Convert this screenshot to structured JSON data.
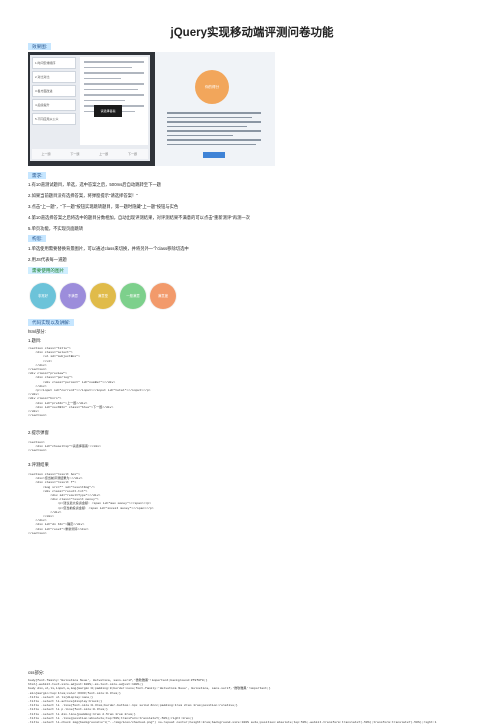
{
  "title": "jQuery实现移动端评测问卷功能",
  "section_effect": "效果图:",
  "demo": {
    "list": [
      "1.时间安排顺序",
      "2.对比对比",
      "3.各方面改进",
      "4.后续提升",
      "5.不同应用从公众"
    ],
    "popup_text": "请选择答案",
    "nav": [
      "上一题",
      "下一题",
      "上一题",
      "下一题"
    ],
    "circle_text": "你的得分"
  },
  "section_requirements": "需求:",
  "requirements": [
    "1.有10道测试题目，单选，选中答案之后，500ms后自动跳转至下一题",
    "2.如果当前题目没有选择答案，将弹窗提示\"请选择答案！\"",
    "3.点击\"上一题\"，\"下一题\"按钮实现跳转题目，第一题时隐藏\"上一题\"按钮与实色",
    "4.第10道选择答案之后将选中的题目分数相加，自动出现评测结果，对评测结果不满意的可以点击\"重新测评\"再测一次",
    "5.单页功能，不实现页面跳转"
  ],
  "section_analysis": "构思:",
  "analysis": [
    "1.单选使用需要替换背景图片，可以通过class来切换，并将另外一个class移除切选中",
    "2.用JS代表每一道题"
  ],
  "section_images": "需要使用的图片",
  "circles": [
    {
      "label": "非常好",
      "color": "#6cc3d9"
    },
    {
      "label": "不满意",
      "color": "#9c8ddb"
    },
    {
      "label": "满意型",
      "color": "#e0bb4a"
    },
    {
      "label": "一般满意",
      "color": "#7dd08c"
    },
    {
      "label": "满意度",
      "color": "#f29a6b"
    }
  ],
  "section_code": "代码实现以及讲解:",
  "html_part": "html部分:",
  "part1": "1.题目:",
  "code1": [
    "<section class=\"title\">",
    "    <div class=\"select\">",
    "        <ul id=\"subjectBox\">",
    "",
    "        </ul>",
    "    </div>",
    "</section>",
    "<div class=\"preview\">",
    "    <div class=\"porlog\">",
    "        <div class=\"percent\" id=\"numBer\"></div>",
    "    </div>",
    "    <p><input id=\"current\"></input></input id=\"total\"></input></p>",
    "</div>",
    "<div class=\"bnrs\">",
    "    <div id=\"prebtn\">上一题</div>",
    "    <div id=\"nextBtn\" class=\"blue\">下一题</div>",
    "</div>",
    "</section>"
  ],
  "part2": "2.提示弹窗",
  "code2": [
    "<section>",
    "    <div id=\"choseltip\">请选择答案!</div>",
    "</section>"
  ],
  "part3": "3.评测结果",
  "code3": [
    "<section class=\"result box\">",
    "    <div>您当前评测结果为:</div>",
    "    <div class=\"result f\">",
    "        <img src=\"\" id=\"resultImg\"/>",
    "        <div class=\"result-txt\">",
    "            <div id=\"resultType\"></div>",
    "            <div class=\"result money\">",
    "                <p>建议最大投资金额: <span id=\"max money\"></span></p>",
    "                <p>您当前投资金额: <span id=\"invest money\"></span></p>",
    "            </div>",
    "        </div>",
    "    </div>",
    "    <div id=\"dn btn\">确定</div>",
    "    <div id=\"reset\">重新测评</div>",
    "</section>"
  ],
  "css_part": "css部分:",
  "css_lines": [
    "body{font-family:'Helvetica Neue', Helvetica, sans-serif,'微软雅黑'!important;background:#f8f8f8;}",
    "html{-webkit-text-size-adjust:100%;-ms-text-size-adjust:100%;}",
    "body div,ul,li,input,a,img{margin:0;padding:0;border:none;font-family:'Helvetica Neue', Helvetica, sans-serif,'微软雅黑'!important;}",
    ".min{margin:top:1rem;color:#333;font-size:0.3rem;}",
    ".title .select ul li{display:none;}",
    ".title .select li.active{display:block;}",
    ".title .select li .line{font-size:0.3rem;border-bottom:.1px solid #ccc;padding:1rem 2rem 1rem;position:relative;}",
    ".title .select li p.line{font-size:0.3rem;}",
    ".title .select li div.line{padding:1rem 2.5rem 1rem 2rem;}",
    ".title .select li .line{position:absolute;top:50%;transform:translateY(-50%);right:1rem;}",
    ".title .select li.check img{background:url(\"../img/icon/checked.png\") no-repeat center;height:2rem;background-size:100% auto;position:absolute;top:50%;-webkit-transform:translateY(-50%);transform:translateY(-50%);right:1"
  ]
}
